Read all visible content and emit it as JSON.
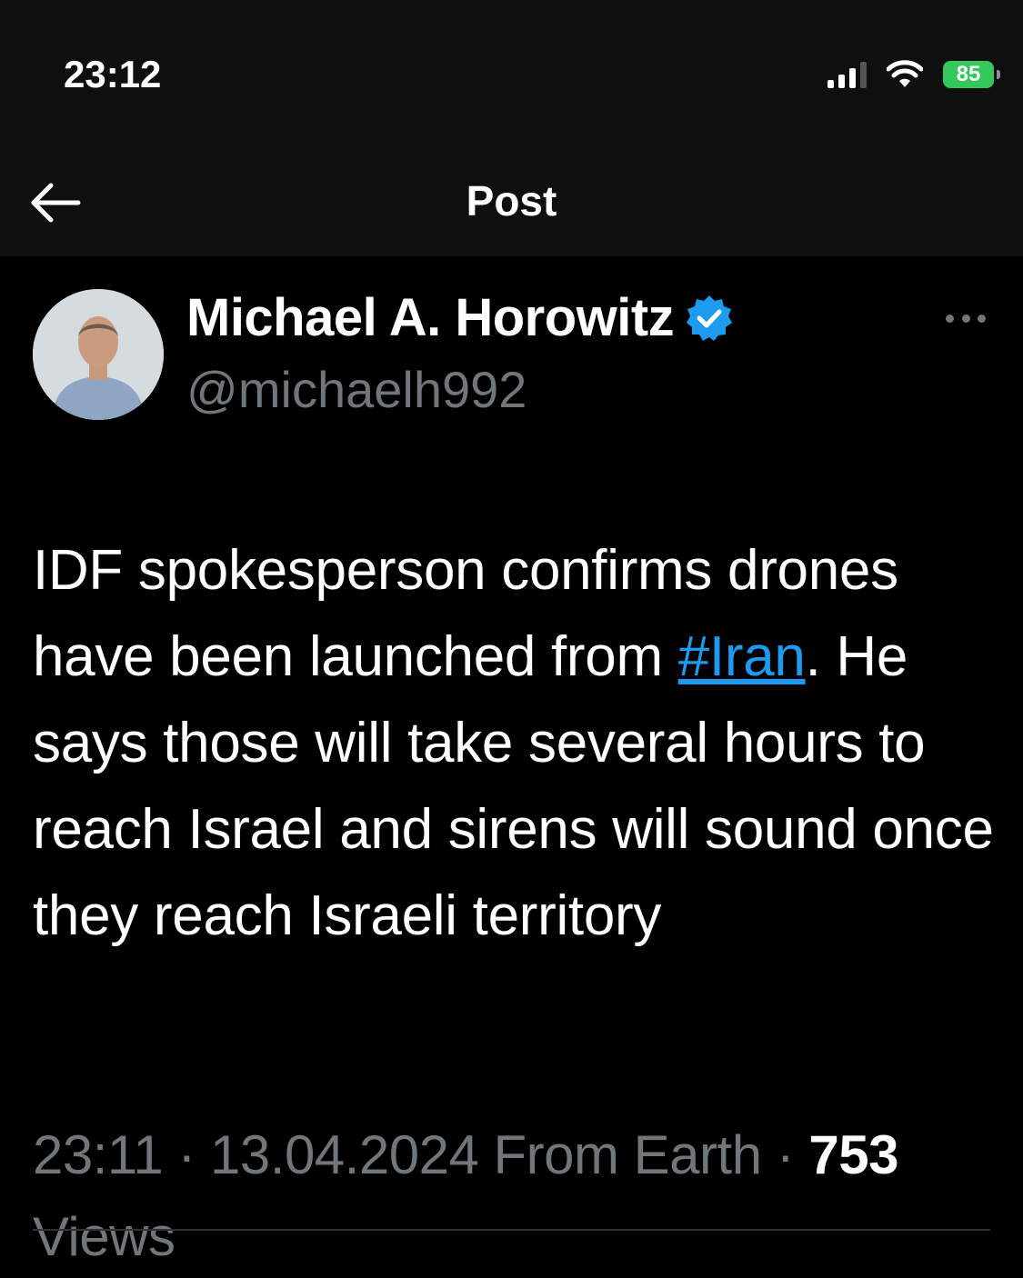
{
  "status_bar": {
    "time": "23:12",
    "battery_level": "85",
    "icons": [
      "cellular-signal-icon",
      "wifi-icon",
      "battery-charging-icon"
    ],
    "battery_color": "#34c759"
  },
  "nav": {
    "title": "Post",
    "back_icon": "arrow-left-icon"
  },
  "post": {
    "author": {
      "name": "Michael A. Horowitz",
      "handle": "@michaelh992",
      "verified": true,
      "verified_color": "#1d9bf0"
    },
    "text_before": "IDF spokesperson confirms drones have been launched from ",
    "hashtag": "#Iran",
    "text_after": ". He says those will take several hours to reach Israel and sirens will sound once they reach Israeli territory",
    "time": "23:11",
    "date": "13.04.2024",
    "source": "From Earth",
    "sep": "·",
    "views_count": "753",
    "views_label": "Views"
  },
  "colors": {
    "background": "#000000",
    "header_background": "#0f0f0f",
    "secondary_text": "#71767b",
    "link": "#1d9bf0"
  }
}
